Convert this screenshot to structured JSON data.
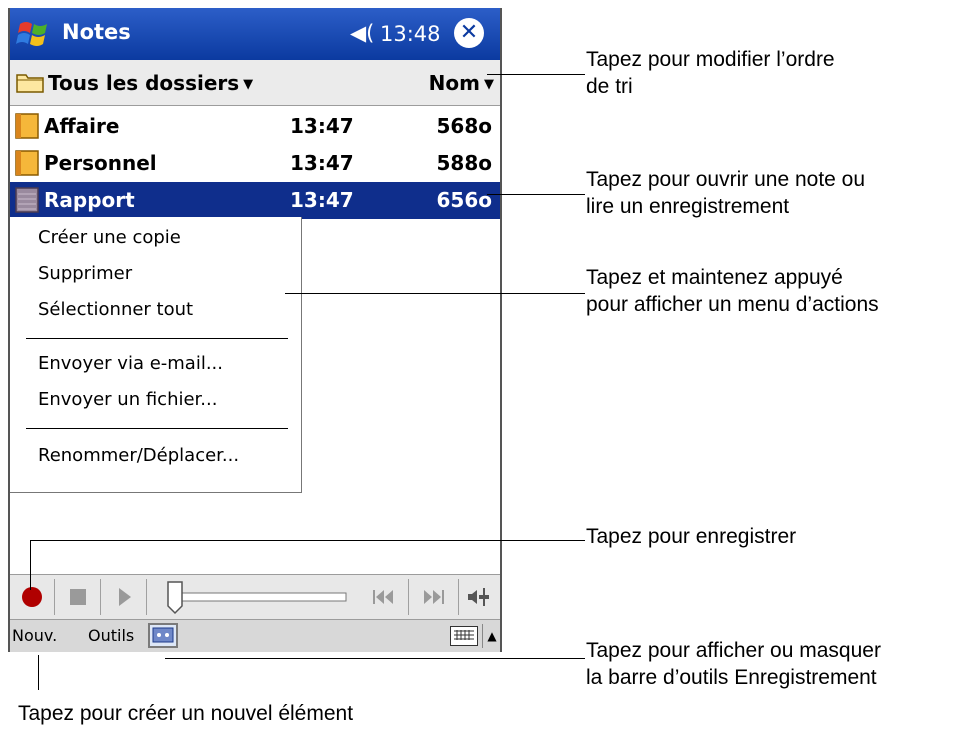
{
  "window": {
    "title": "Notes",
    "time": "13:48",
    "close_glyph": "✕"
  },
  "folderbar": {
    "folder": "Tous les dossiers",
    "sort": "Nom"
  },
  "notes": [
    {
      "name": "Affaire",
      "time": "13:47",
      "size": "568o",
      "icon": "note-icon"
    },
    {
      "name": "Personnel",
      "time": "13:47",
      "size": "588o",
      "icon": "note-icon"
    },
    {
      "name": "Rapport",
      "time": "13:47",
      "size": "656o",
      "icon": "recording-icon"
    }
  ],
  "context_menu": [
    "Créer une copie",
    "Supprimer",
    "Sélectionner tout",
    "Envoyer via e-mail...",
    "Envoyer un fichier...",
    "Renommer/Déplacer..."
  ],
  "menubar": {
    "new": "Nouv.",
    "tools": "Outils"
  },
  "callouts": {
    "sort": [
      "Tapez pour modifier l’ordre",
      "de tri"
    ],
    "open": [
      "Tapez pour ouvrir une note ou",
      "lire un enregistrement"
    ],
    "hold": [
      "Tapez et maintenez appuyé",
      "pour afficher un menu d’actions"
    ],
    "record": [
      "Tapez pour enregistrer"
    ],
    "toolbar": [
      "Tapez pour afficher ou masquer",
      "la barre d’outils Enregistrement"
    ],
    "new": [
      "Tapez pour créer un nouvel élément"
    ]
  },
  "colors": {
    "titlebar": "#0b3aa0",
    "selection": "#0f2e8c",
    "record": "#b00000"
  }
}
